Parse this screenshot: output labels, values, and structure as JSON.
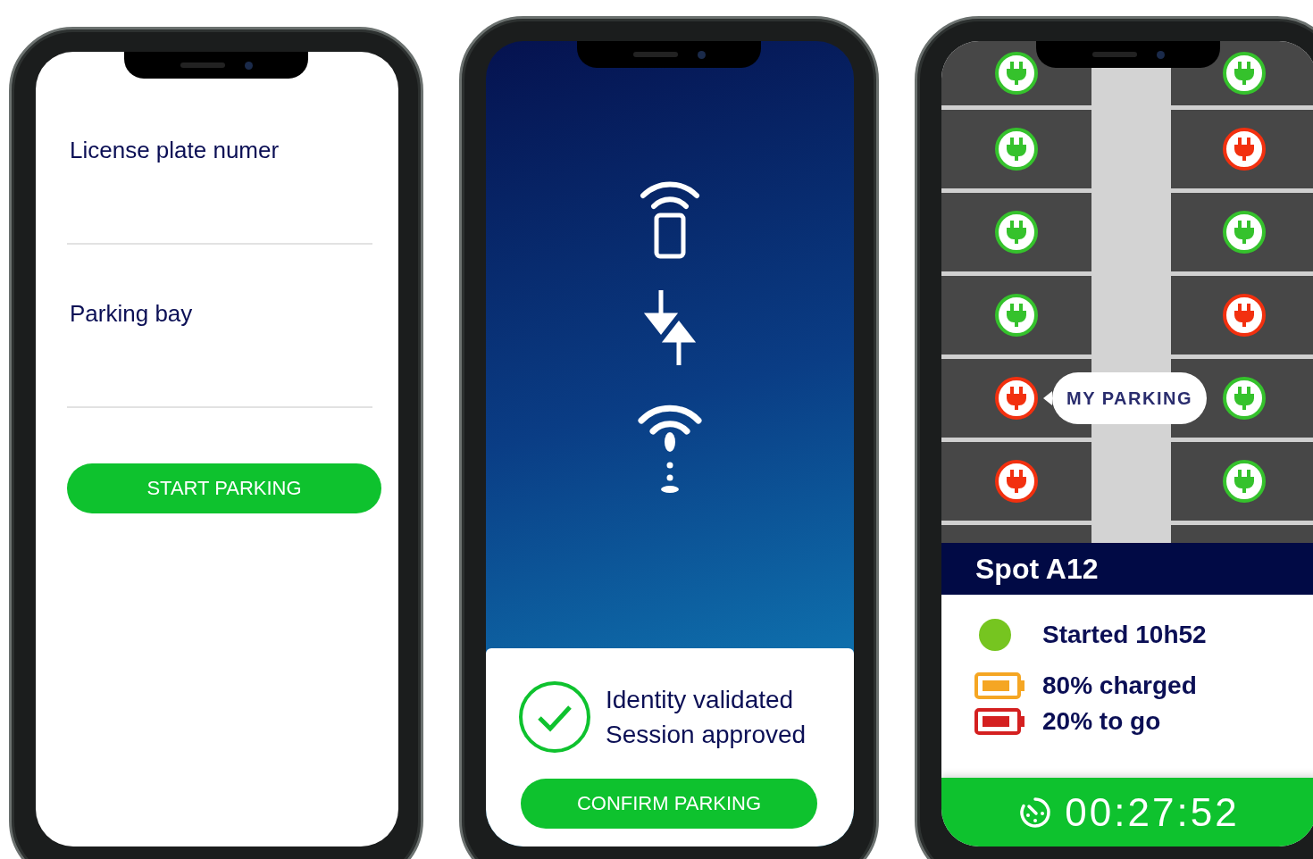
{
  "phones": [
    {
      "kind": "form",
      "fields": [
        {
          "label": "License plate numer"
        },
        {
          "label": "Parking bay"
        }
      ],
      "button": "START PARKING"
    },
    {
      "kind": "validation",
      "status_lines": [
        "Identity validated",
        "Session approved"
      ],
      "button": "CONFIRM PARKING"
    },
    {
      "kind": "map",
      "map": {
        "callout": "MY PARKING",
        "left_spots": [
          {
            "available": true,
            "mine": false
          },
          {
            "available": true,
            "mine": false
          },
          {
            "available": true,
            "mine": false
          },
          {
            "available": true,
            "mine": false
          },
          {
            "available": false,
            "mine": true
          },
          {
            "available": false,
            "mine": false
          }
        ],
        "right_spots": [
          {
            "available": true,
            "mine": false
          },
          {
            "available": false,
            "mine": false
          },
          {
            "available": true,
            "mine": false
          },
          {
            "available": false,
            "mine": false
          },
          {
            "available": true,
            "mine": false
          },
          {
            "available": true,
            "mine": false
          }
        ]
      },
      "spot_title": "Spot A12",
      "details": [
        {
          "kind": "dot",
          "color": "#76c520",
          "text": "Started 10h52"
        },
        {
          "kind": "battery",
          "color": "#f5a623",
          "text": "80% charged"
        },
        {
          "kind": "battery",
          "color": "#d42020",
          "text": "20% to go"
        }
      ],
      "timer": "00:27:52"
    }
  ]
}
